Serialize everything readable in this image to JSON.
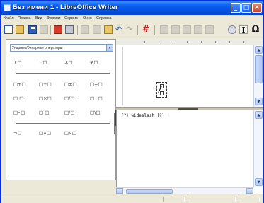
{
  "window": {
    "title": "Без имени 1 - LibreOffice Writer",
    "controls": {
      "minimize": "_",
      "maximize": "□",
      "close": "×"
    }
  },
  "menu": {
    "items": [
      "Файл",
      "Правка",
      "Вид",
      "Формат",
      "Сервис",
      "Окно",
      "Справка"
    ]
  },
  "toolbar": {
    "icons": [
      "new-document-icon",
      "open-icon",
      "save-icon",
      "export-icon",
      "pdf-icon",
      "print-icon",
      "cut-icon",
      "copy-icon",
      "paste-icon",
      "undo-icon",
      "redo-icon",
      "formula-cursor-icon",
      "zoom-in-icon",
      "zoom-out-icon",
      "zoom-100-icon",
      "show-all-icon",
      "update-icon",
      "formula-cursor-icon",
      "symbols-icon"
    ],
    "undo_glyph": "↶",
    "redo_glyph": "↷",
    "cursor_glyph": "I",
    "symbols_glyph": "Ω"
  },
  "elements_panel": {
    "category": "Унарные/бинарные операторы",
    "dropdown_arrow": "▾",
    "rows": [
      [
        "+□",
        "−□",
        "±□",
        "∓□"
      ],
      [
        "□+□",
        "□−□",
        "□±□",
        "□∓□"
      ],
      [
        "□·□",
        "□×□",
        "□∕□",
        "□÷□"
      ],
      [
        "□∘□",
        "□⋅□",
        "□/□",
        "□\\□"
      ],
      [
        "¬□",
        "□∧□",
        "□∨□"
      ]
    ],
    "fraction_glyph": "□/□"
  },
  "document": {
    "placeholder_glyph": "∕"
  },
  "command": {
    "text": "{?} wideslash {?} |"
  },
  "colors": {
    "titlebar": "#0a5ef0",
    "window_frame": "#0831d9",
    "chrome": "#ece9d8",
    "scrollbar": "#c9d9f8"
  }
}
